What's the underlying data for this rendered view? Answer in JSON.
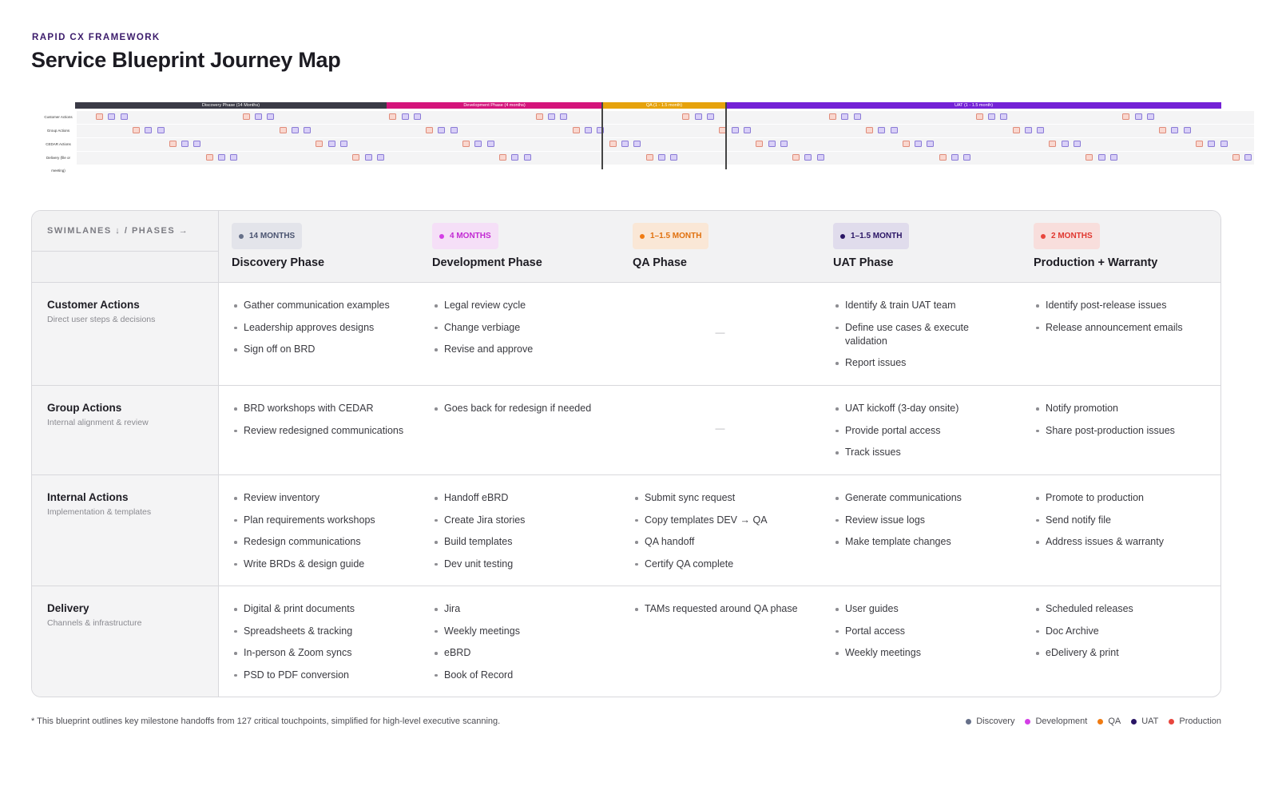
{
  "header": {
    "eyebrow": "RAPID CX FRAMEWORK",
    "title": "Service Blueprint Journey Map"
  },
  "overview": {
    "phases": [
      {
        "label": "Discovery Phase (14 Months)",
        "color": "#3a3a46"
      },
      {
        "label": "Development Phase (4 months)",
        "color": "#d4147b"
      },
      {
        "label": "QA (1 - 1.5 month)",
        "color": "#e6a20c"
      },
      {
        "label": "UAT (1 - 1.5 month)",
        "color": "#7421d6"
      }
    ],
    "lanes": [
      "Customer Actions",
      "Group Actions",
      "CEDAR Actions",
      "Delivery (file or meeting)"
    ]
  },
  "table": {
    "corner_label": "SWIMLANES ↓ / PHASES →",
    "phases": [
      {
        "name": "Discovery Phase",
        "duration": "14 MONTHS",
        "text_color": "#4a5370",
        "dot_color": "#667089",
        "pill_bg": "#e3e4ea"
      },
      {
        "name": "Development Phase",
        "duration": "4 MONTHS",
        "text_color": "#c22ad3",
        "dot_color": "#d43ee6",
        "pill_bg": "#f5dff7"
      },
      {
        "name": "QA Phase",
        "duration": "1–1.5 MONTH",
        "text_color": "#e0700e",
        "dot_color": "#f07b12",
        "pill_bg": "#fae7d6"
      },
      {
        "name": "UAT Phase",
        "duration": "1–1.5 MONTH",
        "text_color": "#2a1565",
        "dot_color": "#2a1565",
        "pill_bg": "#e0dcec"
      },
      {
        "name": "Production + Warranty",
        "duration": "2 MONTHS",
        "text_color": "#e0372f",
        "dot_color": "#e8463d",
        "pill_bg": "#f8dedc"
      }
    ],
    "lanes": [
      {
        "name": "Customer Actions",
        "sub": "Direct user steps & decisions",
        "cells": [
          [
            "Gather communication examples",
            "Leadership approves designs",
            "Sign off on BRD"
          ],
          [
            "Legal review cycle",
            "Change verbiage",
            "Revise and approve"
          ],
          [],
          [
            "Identify & train UAT team",
            "Define use cases & execute validation",
            "Report issues"
          ],
          [
            "Identify post-release issues",
            "Release announcement emails"
          ]
        ]
      },
      {
        "name": "Group Actions",
        "sub": "Internal alignment & review",
        "cells": [
          [
            "BRD workshops with CEDAR",
            "Review redesigned communications"
          ],
          [
            "Goes back for redesign if needed"
          ],
          [],
          [
            "UAT kickoff (3-day onsite)",
            "Provide portal access",
            "Track issues"
          ],
          [
            "Notify promotion",
            "Share post-production issues"
          ]
        ]
      },
      {
        "name": "Internal Actions",
        "sub": "Implementation & templates",
        "cells": [
          [
            "Review inventory",
            "Plan requirements workshops",
            "Redesign communications",
            "Write BRDs & design guide"
          ],
          [
            "Handoff eBRD",
            "Create Jira stories",
            "Build templates",
            "Dev unit testing"
          ],
          [
            "Submit sync request",
            "Copy templates DEV → QA",
            "QA handoff",
            "Certify QA complete"
          ],
          [
            "Generate communications",
            "Review issue logs",
            "Make template changes"
          ],
          [
            "Promote to production",
            "Send notify file",
            "Address issues & warranty"
          ]
        ]
      },
      {
        "name": "Delivery",
        "sub": "Channels & infrastructure",
        "cells": [
          [
            "Digital & print documents",
            "Spreadsheets & tracking",
            "In-person & Zoom syncs",
            "PSD to PDF conversion"
          ],
          [
            "Jira",
            "Weekly meetings",
            "eBRD",
            "Book of Record"
          ],
          [
            "TAMs requested around QA phase"
          ],
          [
            "User guides",
            "Portal access",
            "Weekly meetings"
          ],
          [
            "Scheduled releases",
            "Doc Archive",
            "eDelivery & print"
          ]
        ]
      }
    ],
    "empty_marker": "—"
  },
  "footer": {
    "note": "* This blueprint outlines key milestone handoffs from 127 critical touchpoints, simplified for high-level executive scanning.",
    "legend": [
      {
        "label": "Discovery",
        "color": "#667089"
      },
      {
        "label": "Development",
        "color": "#d43ee6"
      },
      {
        "label": "QA",
        "color": "#f07b12"
      },
      {
        "label": "UAT",
        "color": "#2a1565"
      },
      {
        "label": "Production",
        "color": "#e8463d"
      }
    ]
  }
}
